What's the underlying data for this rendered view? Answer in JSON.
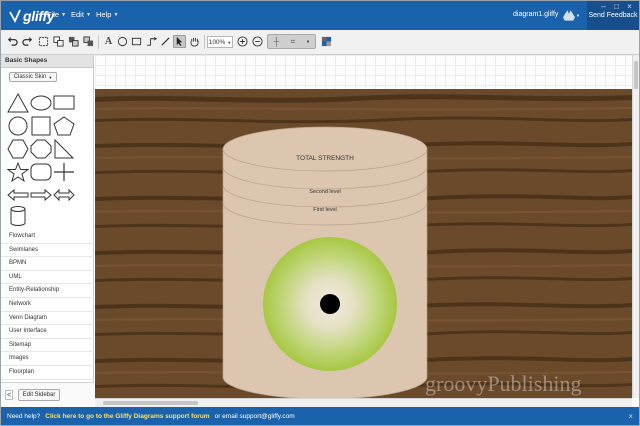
{
  "app": {
    "logo_text": "gliffy",
    "menus": [
      "File",
      "Edit",
      "Help"
    ],
    "document_name": "diagram1.gliffy",
    "feedback_label": "Send Feedback",
    "window_controls": [
      "minimize-icon",
      "maximize-icon",
      "close-icon"
    ]
  },
  "toolbar": {
    "zoom": "100%",
    "tools": [
      "undo-icon",
      "redo-icon",
      "select-all-icon",
      "copy-icon",
      "group-icon",
      "ungroup-icon",
      "text-tool-icon",
      "ellipse-tool-icon",
      "rectangle-tool-icon",
      "connector-tool-icon",
      "line-tool-icon",
      "pointer-tool-icon",
      "hand-tool-icon",
      "zoom-in-icon",
      "zoom-out-icon",
      "snap-icon",
      "grid-icon",
      "layers-icon",
      "theme-icon"
    ]
  },
  "sidebar": {
    "header": "Basic Shapes",
    "skin_label": "Classic Skin",
    "categories": [
      "Flowchart",
      "Swimlanes",
      "BPMN",
      "UML",
      "Entity-Relationship",
      "Network",
      "Venn Diagram",
      "User Interface",
      "Sitemap",
      "Images",
      "Floorplan"
    ],
    "edit_label": "Edit Sidebar",
    "collapse_label": "<"
  },
  "diagram": {
    "title": "TOTAL STRENGTH",
    "levels": [
      "Second level",
      "First level"
    ],
    "colors": {
      "wood": "#6b4a2c",
      "cylinder": "#dcc6b0",
      "ring_outer": "#a6c842",
      "ring_inner": "#eee4d3",
      "center": "#000000"
    }
  },
  "watermark": "groovyPublishing",
  "helpbar": {
    "prompt": "Need help?",
    "link": "Click here to go to the Gliffy Diagrams support forum",
    "email_text": "or email support@gliffy.com",
    "close": "×"
  }
}
